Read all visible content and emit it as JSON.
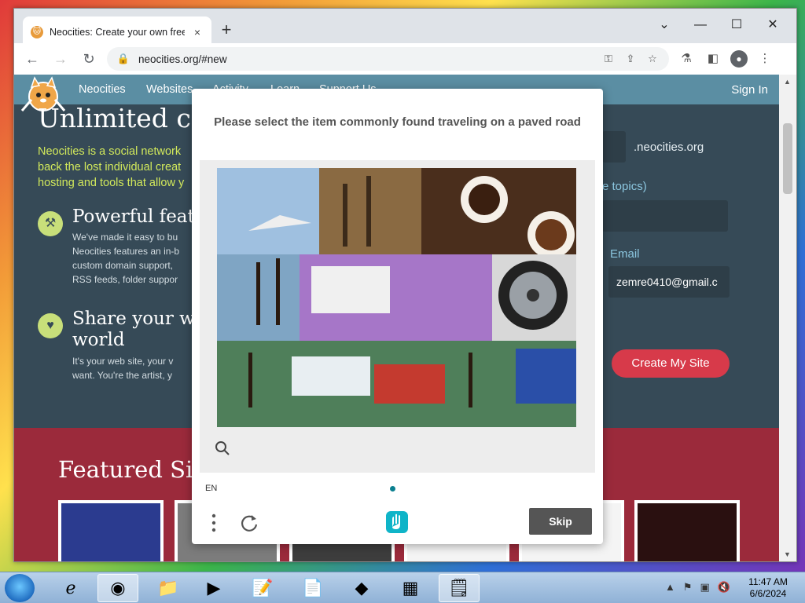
{
  "browser": {
    "tab_title": "Neocities: Create your own free",
    "url": "neocities.org/#new",
    "new_tab": "+",
    "close_tab": "×",
    "window_controls": [
      "⌄",
      "—",
      "☐",
      "✕"
    ]
  },
  "site": {
    "nav": [
      "Neocities",
      "Websites",
      "Activity",
      "Learn",
      "Support Us"
    ],
    "sign_in": "Sign In",
    "hero_title": "Unlimited cr",
    "hero_lines": [
      "Neocities is a social network",
      "back the lost individual creat",
      "hosting and tools that allow y"
    ],
    "features": [
      {
        "icon": "hammer-icon",
        "title": "Powerful featu",
        "lines": [
          "We've made it easy to bu",
          "Neocities features an in-b",
          "custom domain support,",
          "RSS feeds, folder suppor"
        ]
      },
      {
        "icon": "heart-icon",
        "title": "Share your we",
        "title2": "world",
        "lines": [
          "It's your web site, your v",
          "want. You're the artist, y"
        ]
      }
    ],
    "domain_suffix": ".neocities.org",
    "topics_text": "e topics)",
    "email_label": "Email",
    "email_value": "zemre0410@gmail.c",
    "create_button": "Create My Site",
    "featured_title": "Featured Sit"
  },
  "captcha": {
    "prompt": "Please select the item commonly found traveling on a paved road",
    "language": "EN",
    "skip_label": "Skip"
  },
  "taskbar": {
    "time": "11:47 AM",
    "date": "6/6/2024"
  },
  "colors": {
    "site_bg": "#364a57",
    "nav_bg": "#5b8ea3",
    "accent_green": "#d2e95b",
    "create_button": "#d73a4a",
    "featured_bg": "#9b2a3b",
    "skip_button": "#555555"
  }
}
